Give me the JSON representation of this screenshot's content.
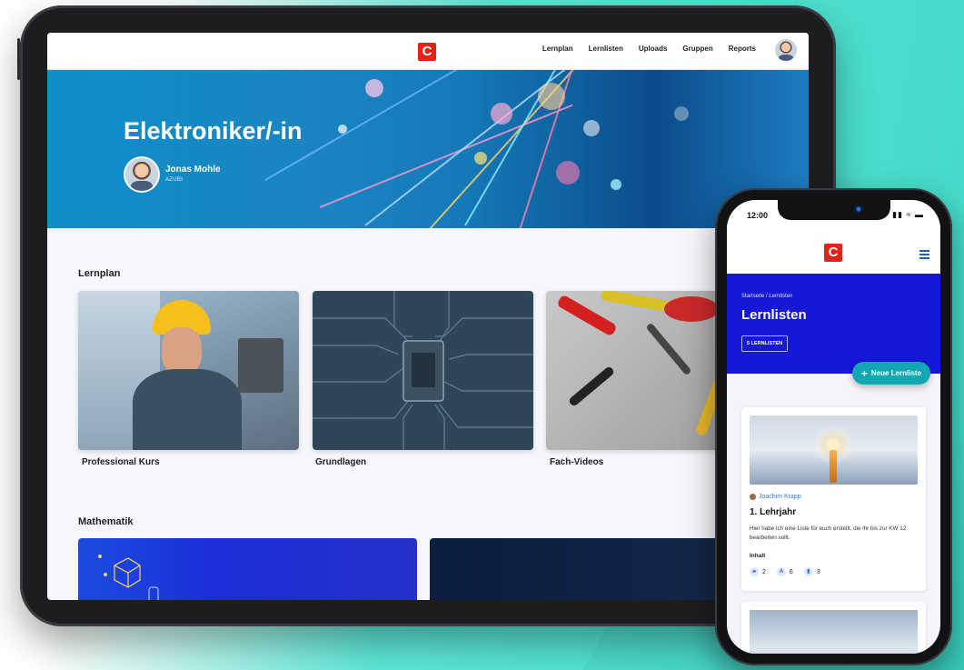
{
  "tablet": {
    "nav": {
      "logo": "C",
      "items": [
        "Lernplan",
        "Lernlisten",
        "Uploads",
        "Gruppen",
        "Reports"
      ]
    },
    "hero": {
      "title": "Elektroniker/-in",
      "user_name": "Jonas Mohle",
      "user_role": "AZUBI"
    },
    "sections": {
      "lernplan_title": "Lernplan",
      "cards": [
        "Professional Kurs",
        "Grundlagen",
        "Fach-Videos"
      ],
      "mathematik_title": "Mathematik"
    }
  },
  "phone": {
    "time": "12:00",
    "status_icons": "▮▮ ≈ ▬",
    "logo": "C",
    "breadcrumb": "Startseite / Lernlisten",
    "title": "Lernlisten",
    "badge": "5 LERNLISTEN",
    "new_button": "Neue Lernliste",
    "card": {
      "author": "Joachim Krapp",
      "title": "1. Lehrjahr",
      "description": "Hier habe ich eine Liste für euch erstellt, die ihr bis zur KW 12 bearbeiten sollt.",
      "content_label": "Inhalt",
      "stats": [
        {
          "icon": "course-icon",
          "value": "2"
        },
        {
          "icon": "text-icon",
          "value": "6"
        },
        {
          "icon": "chart-icon",
          "value": "3"
        }
      ]
    }
  },
  "colors": {
    "brand_red": "#e2231a",
    "banner_blue": "#1717d6",
    "accent_teal": "#14a7b3",
    "background_teal": "#41d9c7"
  }
}
